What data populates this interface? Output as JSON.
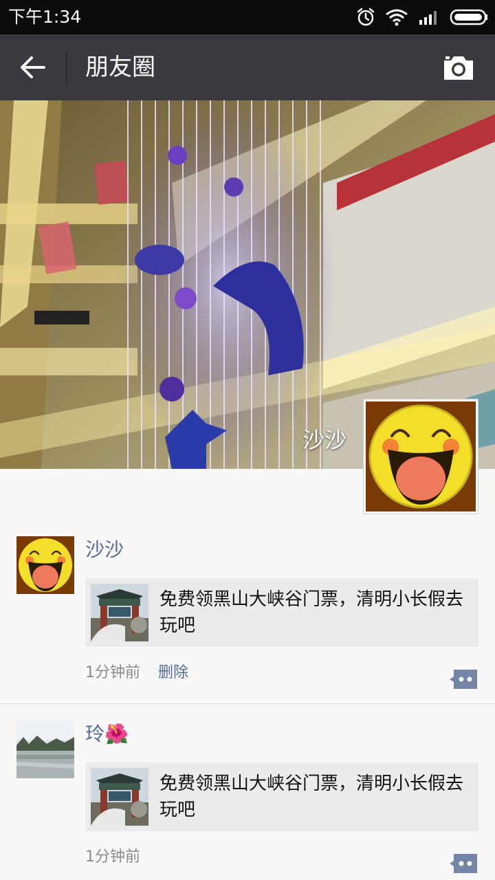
{
  "status_bar": {
    "time": "下午1:34"
  },
  "nav": {
    "title": "朋友圈"
  },
  "cover": {
    "name": "沙沙"
  },
  "posts": [
    {
      "name": "沙沙",
      "share_text": "免费领黑山大峡谷门票，清明小长假去玩吧",
      "time": "1分钟前",
      "delete_label": "删除"
    },
    {
      "name": "玲🌺",
      "share_text": "免费领黑山大峡谷门票，清明小长假去玩吧",
      "time": "1分钟前"
    }
  ],
  "icons": {
    "back": "arrow-left-icon",
    "camera": "camera-icon",
    "comment": "comment-more-icon",
    "alarm": "alarm-icon",
    "wifi": "wifi-icon",
    "signal": "signal-icon",
    "battery": "battery-icon"
  },
  "colors": {
    "status_bar": "#0c0c0c",
    "nav_bar": "#393a3f",
    "name_link": "#576b95",
    "card_bg": "#ebebeb",
    "page_bg": "#f8f8f8"
  }
}
